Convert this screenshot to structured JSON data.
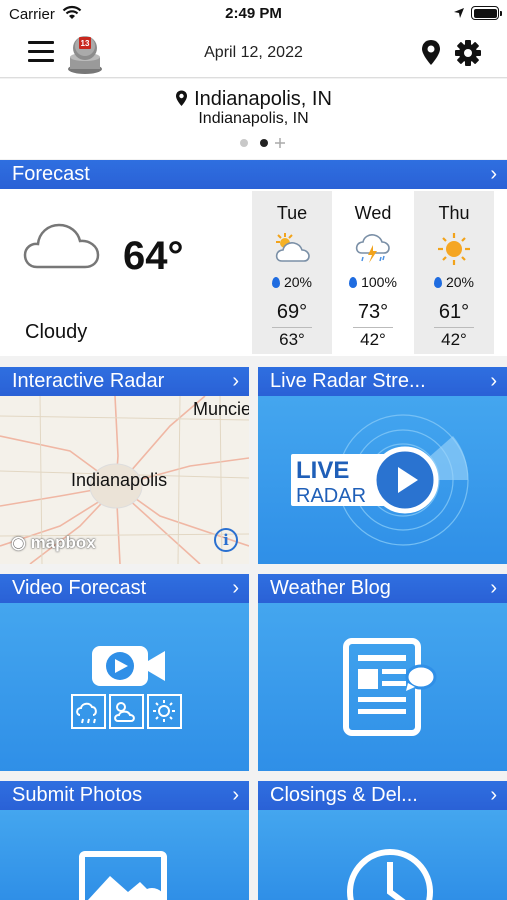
{
  "status_bar": {
    "carrier": "Carrier",
    "time": "2:49 PM"
  },
  "header": {
    "date": "April 12, 2022",
    "logo_icon": "station-13-logo-icon"
  },
  "location": {
    "city": "Indianapolis, IN",
    "subtitle": "Indianapolis, IN"
  },
  "forecast": {
    "title": "Forecast",
    "chevron": "›",
    "current": {
      "temp": "64°",
      "condition": "Cloudy",
      "icon": "cloud-icon"
    },
    "days": [
      {
        "name": "Tue",
        "icon": "partly-cloudy-icon",
        "precip": "20%",
        "high": "69°",
        "low": "63°"
      },
      {
        "name": "Wed",
        "icon": "thunderstorm-icon",
        "precip": "100%",
        "high": "73°",
        "low": "42°"
      },
      {
        "name": "Thu",
        "icon": "sunny-icon",
        "precip": "20%",
        "high": "61°",
        "low": "42°"
      }
    ]
  },
  "tiles": {
    "interactive_radar": {
      "title": "Interactive Radar",
      "map_labels": [
        "Muncie",
        "Indianapolis"
      ],
      "attribution": "mapbox",
      "info": "i"
    },
    "live_radar": {
      "title": "Live Radar Stre...",
      "badge_top": "LIVE",
      "badge_bottom": "RADAR"
    },
    "video_forecast": {
      "title": "Video Forecast"
    },
    "weather_blog": {
      "title": "Weather Blog"
    },
    "submit_photos": {
      "title": "Submit Photos"
    },
    "closings": {
      "title": "Closings & Del..."
    }
  },
  "colors": {
    "header_blue": "#2a61d6",
    "tile_blue": "#3a9cec",
    "precip_blue": "#1f6ce0"
  }
}
